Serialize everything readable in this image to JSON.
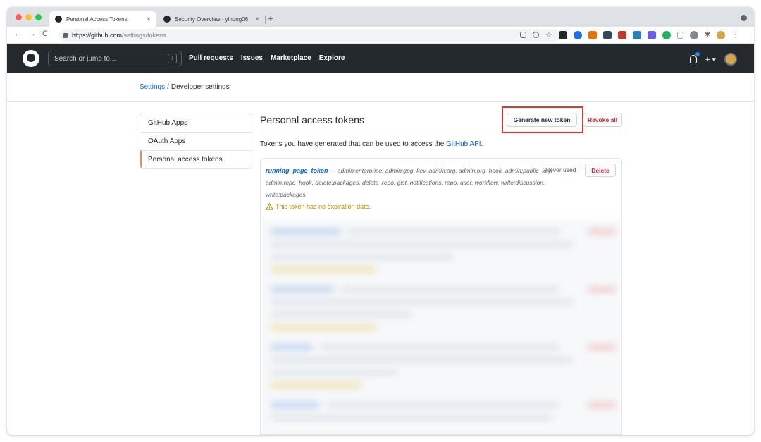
{
  "browser": {
    "tabs": [
      {
        "title": "Personal Access Tokens",
        "close": "×"
      },
      {
        "title": "Security Overview · yihong06",
        "close": "×"
      }
    ],
    "new_tab": "+",
    "url_host": "https://github.com",
    "url_path": "/settings/tokens",
    "nav": {
      "back": "←",
      "forward": "→",
      "reload": "C"
    }
  },
  "header": {
    "search_placeholder": "Search or jump to...",
    "search_shortcut": "/",
    "nav_items": [
      "Pull requests",
      "Issues",
      "Marketplace",
      "Explore"
    ],
    "plus": "+ ▾"
  },
  "breadcrumb": {
    "parent": "Settings",
    "separator": "/",
    "current": "Developer settings"
  },
  "sidebar": {
    "items": [
      "GitHub Apps",
      "OAuth Apps",
      "Personal access tokens"
    ]
  },
  "main": {
    "title": "Personal access tokens",
    "generate_label": "Generate new token",
    "revoke_label": "Revoke all",
    "description_prefix": "Tokens you have generated that can be used to access the ",
    "description_link": "GitHub API",
    "description_suffix": "."
  },
  "token": {
    "name": "running_page_token",
    "scopes": "admin:enterprise, admin:gpg_key, admin:org, admin:org_hook, admin:public_key, admin:repo_hook, delete:packages, delete_repo, gist, notifications, repo, user, workflow, write:discussion, write:packages",
    "dash": "—",
    "last_used": "Never used",
    "delete_label": "Delete",
    "warning": "This token has no expiration date."
  },
  "colors": {
    "accent": "#0366d6",
    "danger": "#cb2431",
    "highlight": "#d73a2a",
    "warning": "#b08800",
    "header_bg": "#24292e"
  },
  "icons": [
    "github-logo-icon",
    "bell-icon",
    "avatar",
    "warning-icon",
    "lock-icon",
    "star-icon",
    "zoom-icon"
  ]
}
